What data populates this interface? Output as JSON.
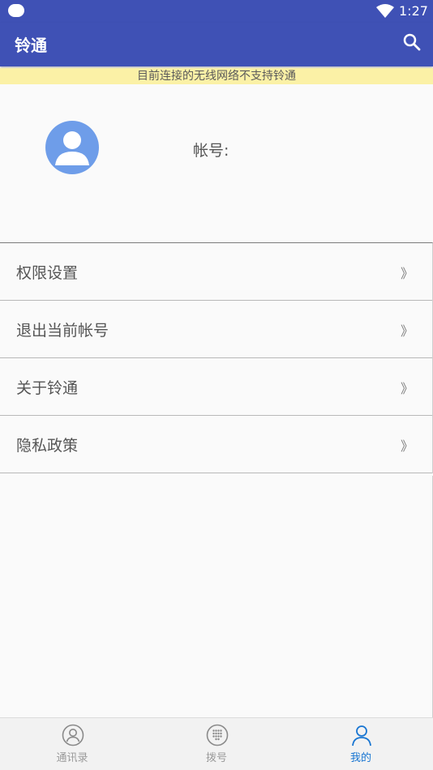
{
  "status_bar": {
    "time": "1:27"
  },
  "app_bar": {
    "title": "铃通"
  },
  "banner": {
    "text": "目前连接的无线网络不支持铃通"
  },
  "profile": {
    "account_label": "帐号:"
  },
  "menu": {
    "items": [
      {
        "label": "权限设置",
        "chevron": "》"
      },
      {
        "label": "退出当前帐号",
        "chevron": "》"
      },
      {
        "label": "关于铃通",
        "chevron": "》"
      },
      {
        "label": "隐私政策",
        "chevron": "》"
      }
    ]
  },
  "bottom_nav": {
    "tabs": [
      {
        "label": "通讯录",
        "icon": "contacts-icon"
      },
      {
        "label": "拨号",
        "icon": "dialpad-icon"
      },
      {
        "label": "我的",
        "icon": "person-icon",
        "active": true
      }
    ]
  },
  "colors": {
    "primary": "#3f51b5",
    "banner": "#fbf1a6",
    "accent": "#1976d2",
    "avatar": "#6e9de9"
  }
}
